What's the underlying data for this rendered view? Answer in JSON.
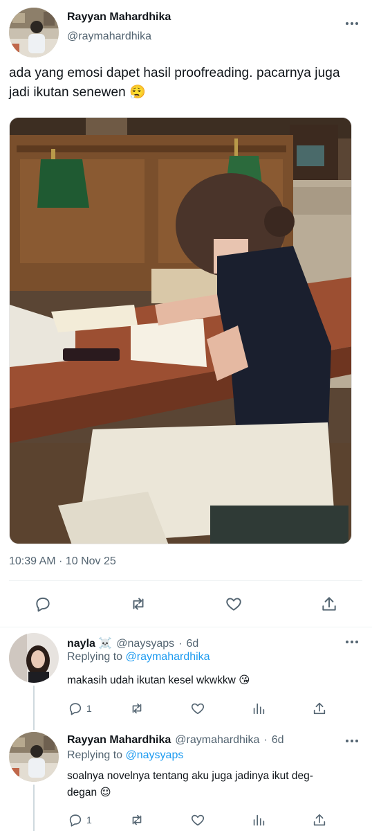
{
  "tweet": {
    "author_name": "Rayyan Mahardhika",
    "author_handle": "@raymahardhika",
    "text": "ada yang emosi dapet hasil proofreading. pacarnya juga jadi ikutan senewen 😮‍💨",
    "timestamp": "10:39 AM · 10 Nov 25"
  },
  "replies": [
    {
      "name": "nayla ☠️",
      "handle": "@naysyaps",
      "age": "6d",
      "replying_label": "Replying to",
      "replying_to": "@raymahardhika",
      "text": "makasih udah ikutan kesel wkwkkw 😘",
      "reply_count": "1"
    },
    {
      "name": "Rayyan Mahardhika",
      "handle": "@raymahardhika",
      "age": "6d",
      "replying_label": "Replying to",
      "replying_to": "@naysyaps",
      "text_line1": "soalnya novelnya tentang aku juga jadinya ikut deg-",
      "text_line2": "degan 😌",
      "reply_count": "1"
    }
  ],
  "icons": {
    "reply": "reply-icon",
    "retweet": "retweet-icon",
    "like": "heart-icon",
    "views": "views-icon",
    "share": "share-icon",
    "more": "more-icon"
  },
  "colors": {
    "link": "#1d9bf0",
    "secondary_text": "#536471",
    "thread_line": "#cfd9de"
  }
}
